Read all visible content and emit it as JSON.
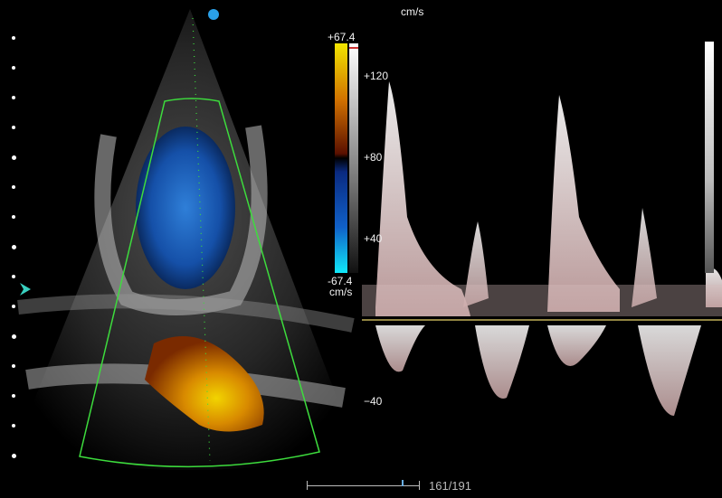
{
  "header": {
    "units_top": "cm/s"
  },
  "color_scale": {
    "max": "+67.4",
    "min": "-67.4",
    "unit": "cm/s"
  },
  "doppler": {
    "ticks": [
      "+120",
      "+80",
      "+40",
      "−40"
    ],
    "baseline_color": "#e8d26a"
  },
  "footer": {
    "frame_counter": "161/191"
  },
  "colors": {
    "sector_outline": "#3ddc3d",
    "marker_blue": "#2aa0e8",
    "marker_teal": "#38d0c0"
  },
  "icons": [
    "probe-orientation-dot",
    "depth-marker-icon"
  ]
}
